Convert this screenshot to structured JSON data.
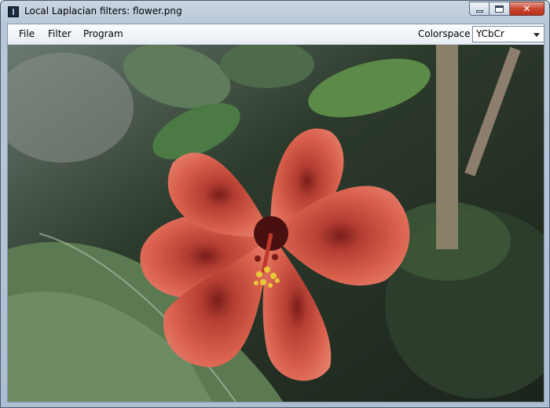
{
  "window": {
    "title": "Local Laplacian filters: flower.png",
    "close_symbol": "✕"
  },
  "menu": {
    "file": "File",
    "filter": "Filter",
    "program": "Program"
  },
  "colorspace": {
    "label": "Colorspace",
    "selected": "YCbCr"
  },
  "image": {
    "subject": "red hibiscus flower",
    "background": "green leaves and stems",
    "colors": {
      "petal": "#d65a48",
      "petal_dark": "#a8382e",
      "center": "#5a1515",
      "stamen": "#e8c83a",
      "leaf": "#4f7a45",
      "leaf_dark": "#243a24"
    }
  },
  "icons": {
    "app": "app-icon",
    "minimize": "minimize-icon",
    "maximize": "maximize-icon",
    "close": "close-icon",
    "dropdown": "chevron-down-icon"
  }
}
